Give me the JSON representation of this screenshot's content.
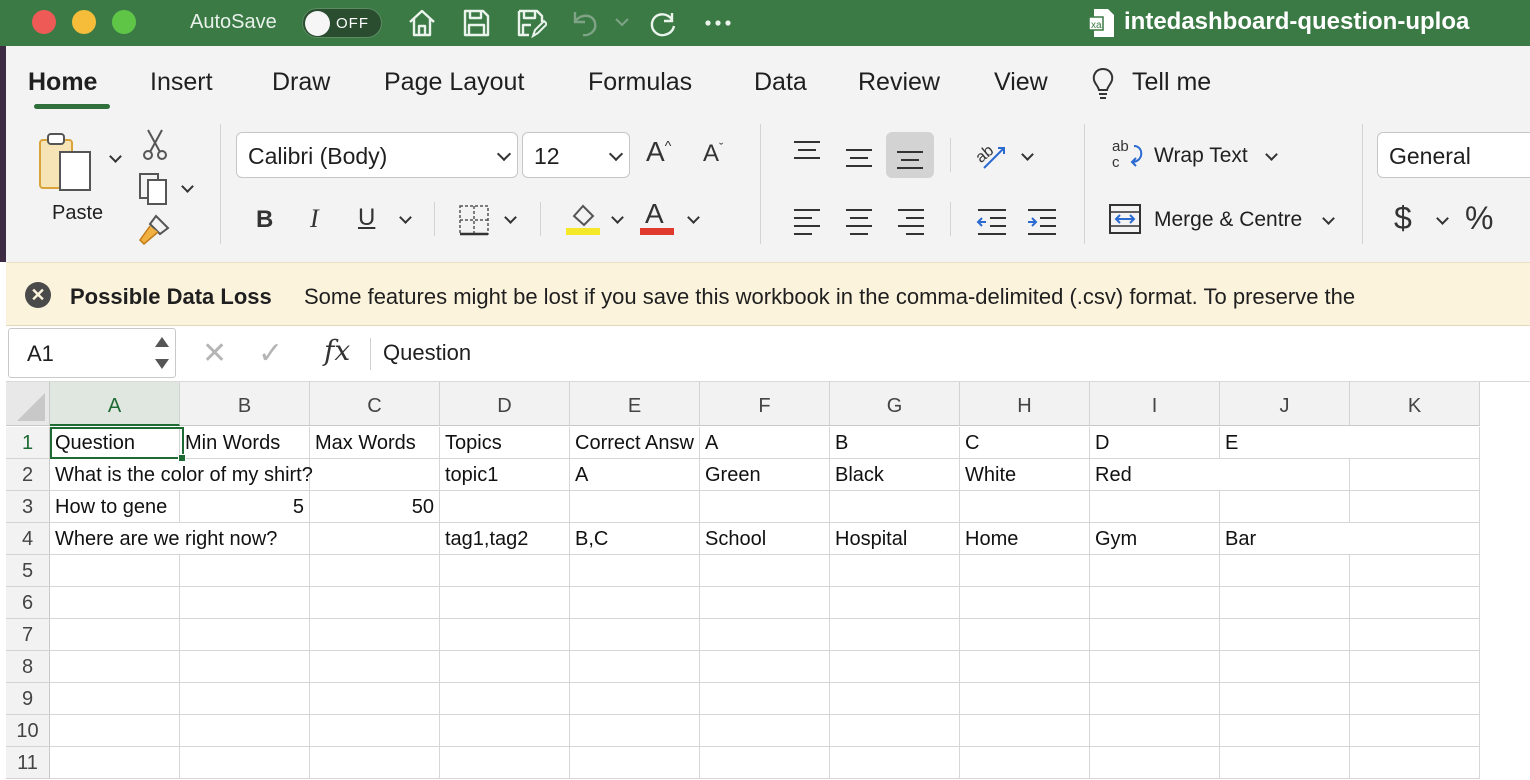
{
  "titlebar": {
    "autosave_label": "AutoSave",
    "autosave_state": "OFF",
    "file_title": "intedashboard-question-uploa",
    "window_controls": [
      "close",
      "minimize",
      "zoom"
    ],
    "icons": [
      "home-icon",
      "save-icon",
      "save-as-icon",
      "undo-icon",
      "redo-icon",
      "more-icon"
    ]
  },
  "ribbon": {
    "tabs": [
      "Home",
      "Insert",
      "Draw",
      "Page Layout",
      "Formulas",
      "Data",
      "Review",
      "View",
      "Tell me"
    ],
    "active_tab": "Home",
    "paste_label": "Paste",
    "font_name": "Calibri (Body)",
    "font_size": "12",
    "bold": "B",
    "italic": "I",
    "underline": "U",
    "wrap_text": "Wrap Text",
    "merge_centre": "Merge & Centre",
    "number_format": "General",
    "currency": "$",
    "percent": "%",
    "highlight_color": "#f5e829",
    "font_color": "#e03a2f"
  },
  "infobar": {
    "title": "Possible Data Loss",
    "message": "Some features might be lost if you save this workbook in the comma-delimited (.csv) format. To preserve the"
  },
  "formula_bar": {
    "name_box": "A1",
    "cancel": "✕",
    "enter": "✓",
    "fx": "fx",
    "content": "Question"
  },
  "sheet": {
    "columns": [
      "A",
      "B",
      "C",
      "D",
      "E",
      "F",
      "G",
      "H",
      "I",
      "J",
      "K"
    ],
    "rows": [
      "1",
      "2",
      "3",
      "4",
      "5",
      "6",
      "7",
      "8",
      "9",
      "10",
      "11"
    ],
    "selected_cell": "A1",
    "cells": {
      "A1": "Question",
      "B1": "Min Words",
      "C1": "Max Words",
      "D1": "Topics",
      "E1": "Correct Answ",
      "F1": "A",
      "G1": "B",
      "H1": "C",
      "I1": "D",
      "J1": "E",
      "A2": "What is the color of my shirt?",
      "D2": "topic1",
      "E2": "A",
      "F2": "Green",
      "G2": "Black",
      "H2": "White",
      "I2": "Red",
      "A3": "How to gene",
      "B3": "5",
      "C3": "50",
      "A4": "Where are we right now?",
      "D4": "tag1,tag2",
      "E4": "B,C",
      "F4": "School",
      "G4": "Hospital",
      "H4": "Home",
      "I4": "Gym",
      "J4": "Bar"
    }
  }
}
